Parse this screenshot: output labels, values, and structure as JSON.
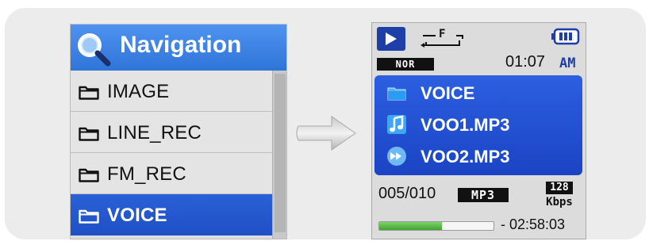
{
  "navigation": {
    "title": "Navigation",
    "items": [
      {
        "label": "IMAGE",
        "selected": false
      },
      {
        "label": "LINE_REC",
        "selected": false
      },
      {
        "label": "FM_REC",
        "selected": false
      },
      {
        "label": "VOICE",
        "selected": true
      }
    ]
  },
  "player": {
    "play_state": "play",
    "ab_repeat_label": "F",
    "eq_mode": "NOR",
    "clock": "01:07",
    "ampm": "AM",
    "files": [
      {
        "name": "VOICE",
        "icon": "folder-icon"
      },
      {
        "name": "VOO1.MP3",
        "icon": "music-note-icon"
      },
      {
        "name": "VOO2.MP3",
        "icon": "forward-icon"
      }
    ],
    "track_counter": "005/010",
    "format": "MP3",
    "bitrate": "128",
    "bitrate_unit": "Kbps",
    "progress_fraction": 0.55,
    "remaining_time": "- 02:58:03"
  },
  "colors": {
    "selection_blue": "#2a61d6",
    "header_blue": "#3f84e6",
    "progress_green": "#4fb53c"
  }
}
